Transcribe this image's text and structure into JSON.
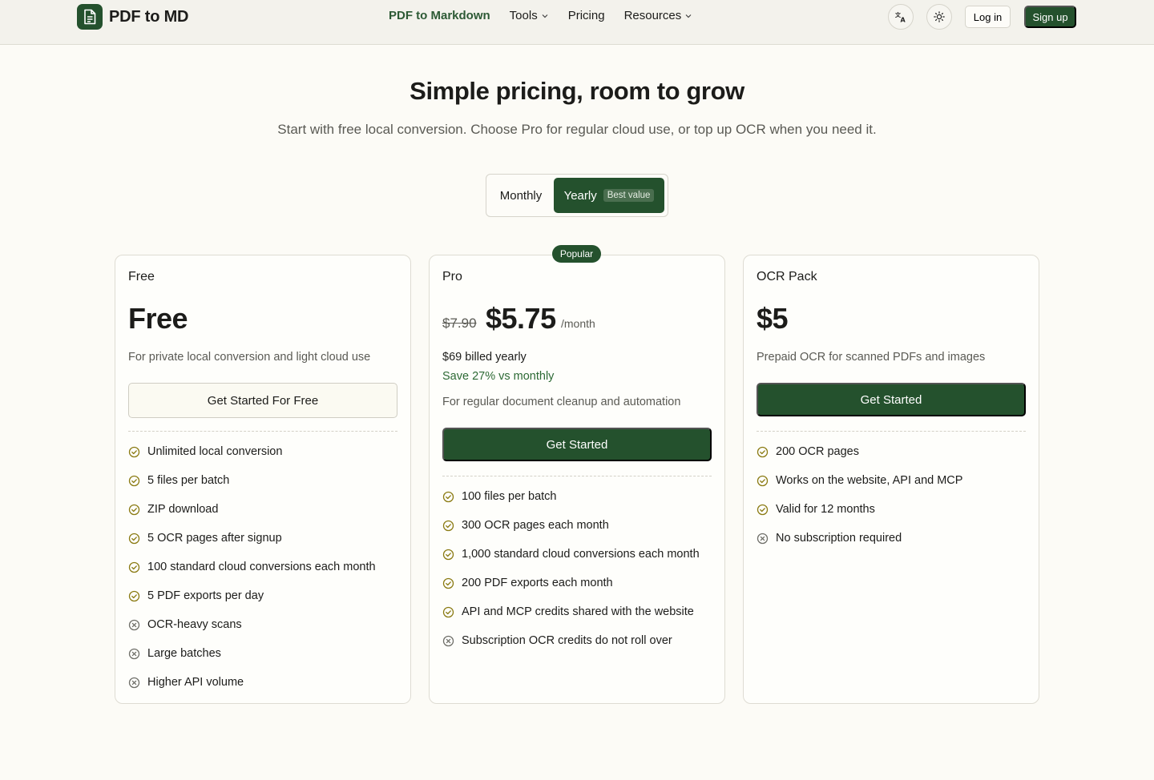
{
  "brand": {
    "name": "PDF to MD"
  },
  "nav": {
    "items": [
      {
        "label": "PDF to Markdown",
        "active": true,
        "dropdown": false
      },
      {
        "label": "Tools",
        "active": false,
        "dropdown": true
      },
      {
        "label": "Pricing",
        "active": false,
        "dropdown": false
      },
      {
        "label": "Resources",
        "active": false,
        "dropdown": true
      }
    ],
    "language_icon": "translate-icon",
    "theme_icon": "sun-icon",
    "login_label": "Log in",
    "signup_label": "Sign up"
  },
  "hero": {
    "title": "Simple pricing, room to grow",
    "subtitle": "Start with free local conversion. Choose Pro for regular cloud use, or top up OCR when you need it."
  },
  "billing_toggle": {
    "monthly_label": "Monthly",
    "yearly_label": "Yearly",
    "yearly_badge": "Best value",
    "selected": "Yearly"
  },
  "plans": {
    "free": {
      "name": "Free",
      "price": "Free",
      "description": "For private local conversion and light cloud use",
      "cta": "Get Started For Free",
      "features": [
        {
          "text": "Unlimited local conversion",
          "included": true
        },
        {
          "text": "5 files per batch",
          "included": true
        },
        {
          "text": "ZIP download",
          "included": true
        },
        {
          "text": "5 OCR pages after signup",
          "included": true
        },
        {
          "text": "100 standard cloud conversions each month",
          "included": true
        },
        {
          "text": "5 PDF exports per day",
          "included": true
        },
        {
          "text": "OCR-heavy scans",
          "included": false
        },
        {
          "text": "Large batches",
          "included": false
        },
        {
          "text": "Higher API volume",
          "included": false
        }
      ]
    },
    "pro": {
      "badge": "Popular",
      "name": "Pro",
      "old_price": "$7.90",
      "price": "$5.75",
      "period": "/month",
      "billed": "$69 billed yearly",
      "save": "Save 27% vs monthly",
      "description": "For regular document cleanup and automation",
      "cta": "Get Started",
      "features": [
        {
          "text": "100 files per batch",
          "included": true
        },
        {
          "text": "300 OCR pages each month",
          "included": true
        },
        {
          "text": "1,000 standard cloud conversions each month",
          "included": true
        },
        {
          "text": "200 PDF exports each month",
          "included": true
        },
        {
          "text": "API and MCP credits shared with the website",
          "included": true
        },
        {
          "text": "Subscription OCR credits do not roll over",
          "included": false
        }
      ]
    },
    "ocr": {
      "name": "OCR Pack",
      "price": "$5",
      "description": "Prepaid OCR for scanned PDFs and images",
      "cta": "Get Started",
      "features": [
        {
          "text": "200 OCR pages",
          "included": true
        },
        {
          "text": "Works on the website, API and MCP",
          "included": true
        },
        {
          "text": "Valid for 12 months",
          "included": true
        },
        {
          "text": "No subscription required",
          "included": false
        }
      ]
    }
  },
  "colors": {
    "brand_green": "#24512d",
    "check_yellow": "#8a7a12",
    "x_gray": "#6e6e68",
    "background": "#fcfbf6"
  }
}
